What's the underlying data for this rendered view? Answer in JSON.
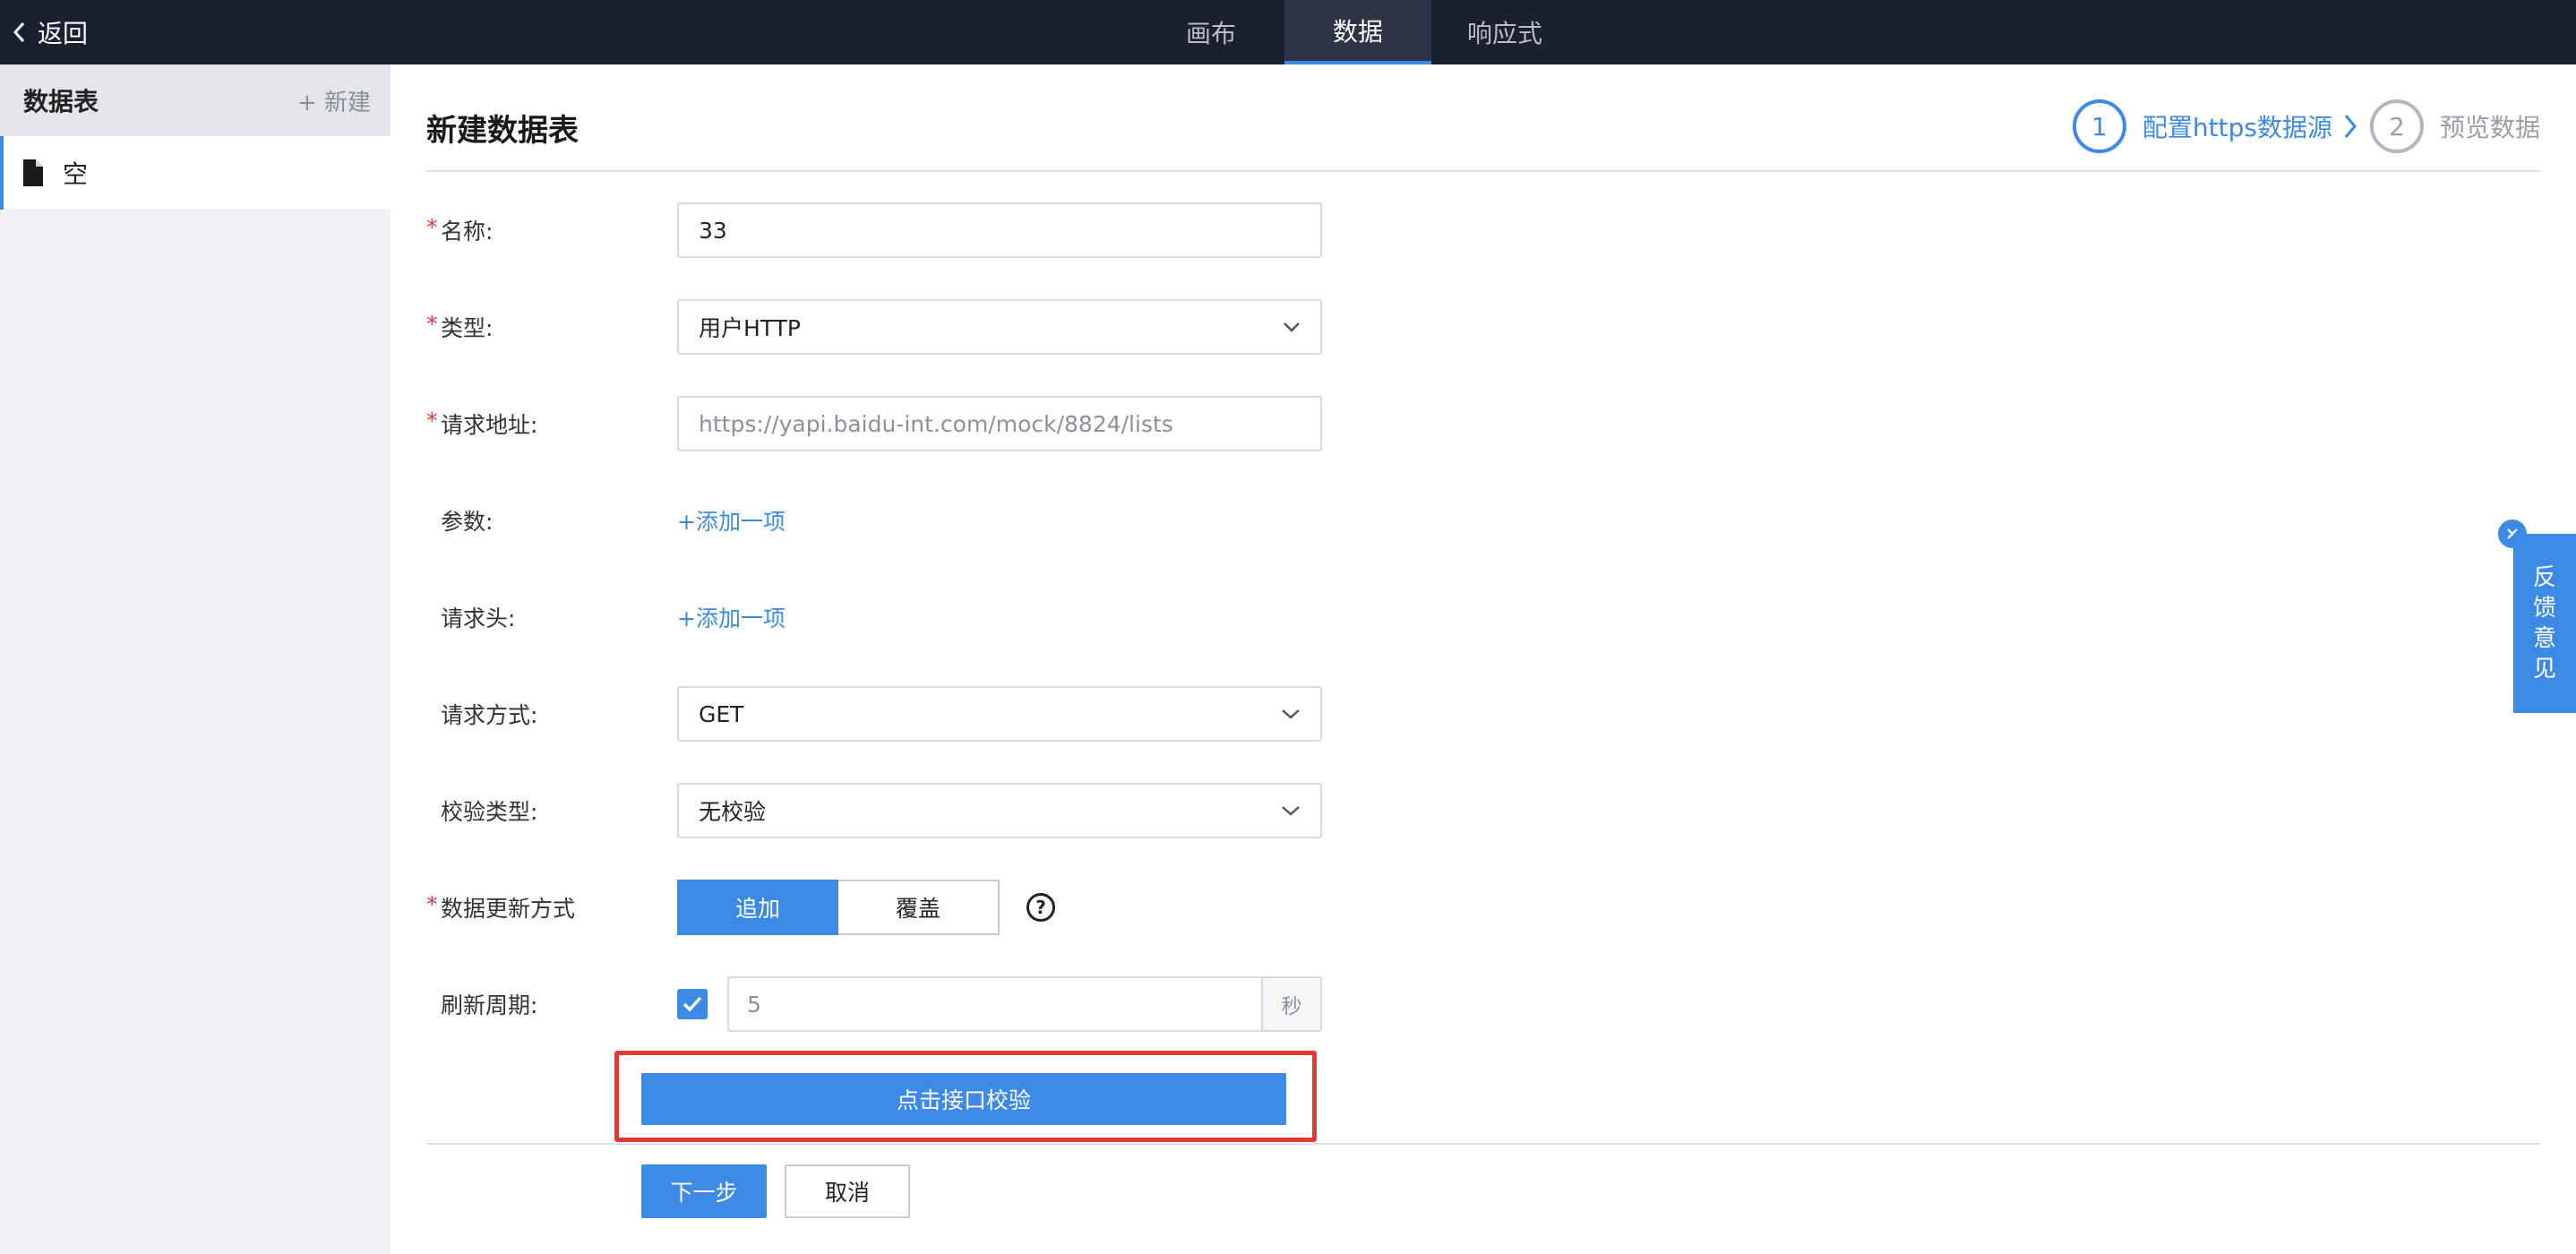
{
  "topbar": {
    "back_label": "返回",
    "tabs": [
      {
        "label": "画布"
      },
      {
        "label": "数据"
      },
      {
        "label": "响应式"
      }
    ],
    "active_tab": "数据"
  },
  "sidebar": {
    "title": "数据表",
    "new_label": "+ 新建",
    "items": [
      {
        "label": "空",
        "icon": "file-icon"
      }
    ]
  },
  "main": {
    "title": "新建数据表",
    "steps": [
      {
        "number": "1",
        "label": "配置https数据源",
        "state": "active"
      },
      {
        "number": "2",
        "label": "预览数据",
        "state": "inactive"
      }
    ],
    "form": {
      "name": {
        "label": "名称:",
        "value": "33",
        "required": true
      },
      "type": {
        "label": "类型:",
        "value": "用户HTTP",
        "required": true
      },
      "url": {
        "label": "请求地址:",
        "placeholder": "https://yapi.baidu-int.com/mock/8824/lists",
        "required": true
      },
      "params": {
        "label": "参数:",
        "link": "+添加一项"
      },
      "headers": {
        "label": "请求头:",
        "link": "+添加一项"
      },
      "method": {
        "label": "请求方式:",
        "value": "GET"
      },
      "verify_type": {
        "label": "校验类型:",
        "value": "无校验"
      },
      "update_mode": {
        "label": "数据更新方式",
        "required": true,
        "options": [
          "追加",
          "覆盖"
        ],
        "selected": "追加",
        "help": "?"
      },
      "refresh": {
        "label": "刷新周期:",
        "checked": true,
        "value": "5",
        "unit": "秒"
      }
    },
    "verify_button": "点击接口校验",
    "next_button": "下一步",
    "cancel_button": "取消"
  },
  "feedback": {
    "chars": [
      "反",
      "馈",
      "意",
      "见"
    ]
  },
  "colors": {
    "accent": "#3c8ae6",
    "topbar": "#1b2030",
    "highlight": "#e03a33",
    "required": "#e23a3a"
  }
}
